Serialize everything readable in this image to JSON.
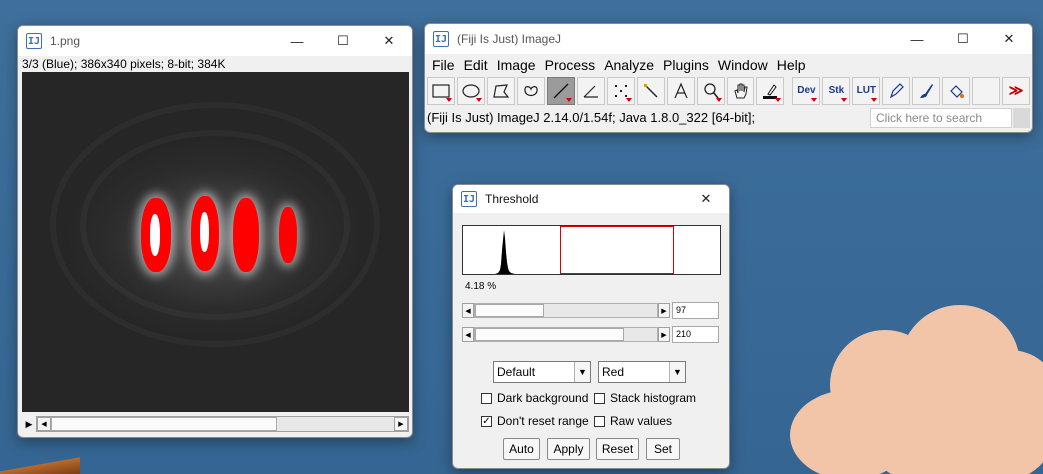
{
  "image_window": {
    "title": "1.png",
    "info": "3/3 (Blue); 386x340 pixels; 8-bit; 384K"
  },
  "imagej_window": {
    "title": "(Fiji Is Just) ImageJ",
    "menus": [
      "File",
      "Edit",
      "Image",
      "Process",
      "Analyze",
      "Plugins",
      "Window",
      "Help"
    ],
    "tool_text": {
      "dev": "Dev",
      "stk": "Stk",
      "lut": "LUT"
    },
    "status": "(Fiji Is Just) ImageJ 2.14.0/1.54f; Java 1.8.0_322 [64-bit];",
    "search_placeholder": "Click here to search"
  },
  "threshold_window": {
    "title": "Threshold",
    "percent": "4.18 %",
    "min_value": "97",
    "max_value": "210",
    "min_fraction": 0.38,
    "max_fraction": 0.82,
    "method": "Default",
    "display_mode": "Red",
    "checkboxes": {
      "dark_background": {
        "label": "Dark background",
        "checked": false
      },
      "stack_histogram": {
        "label": "Stack histogram",
        "checked": false
      },
      "dont_reset_range": {
        "label": "Don't reset range",
        "checked": true
      },
      "raw_values": {
        "label": "Raw values",
        "checked": false
      }
    },
    "buttons": {
      "auto": "Auto",
      "apply": "Apply",
      "reset": "Reset",
      "set": "Set"
    }
  },
  "window_controls": {
    "minimize": "—",
    "maximize": "☐",
    "close": "✕"
  },
  "colors": {
    "threshold_overlay": "#ff0000",
    "desktop": "#3a6b98"
  }
}
